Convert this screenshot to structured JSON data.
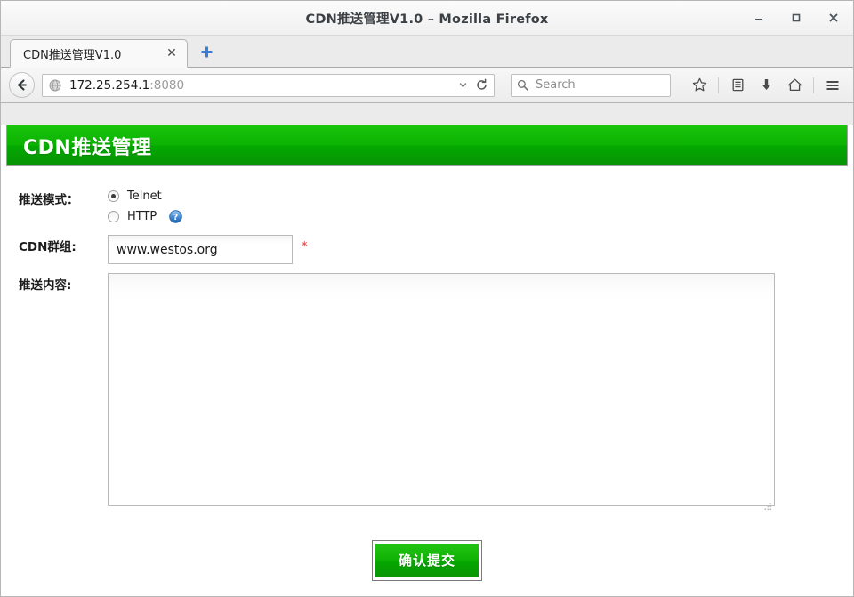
{
  "window": {
    "title": "CDN推送管理V1.0 – Mozilla Firefox",
    "minimize_label": "–",
    "maximize_label": "□",
    "close_label": "×"
  },
  "browser": {
    "tab": {
      "label": "CDN推送管理V1.0",
      "close_label": "✕"
    },
    "new_tab_label": "+",
    "back_label": "Back",
    "url": {
      "host": "172.25.254.1",
      "port": ":8080",
      "full": "172.25.254.1:8080"
    },
    "search": {
      "placeholder": "Search"
    },
    "toolbar_icons": [
      {
        "name": "bookmark-star-icon",
        "label": "Bookmark this page"
      },
      {
        "name": "library-icon",
        "label": "Show your bookmarks"
      },
      {
        "name": "downloads-icon",
        "label": "Downloads"
      },
      {
        "name": "home-icon",
        "label": "Home"
      },
      {
        "name": "menu-hamburger-icon",
        "label": "Open menu"
      }
    ]
  },
  "page": {
    "banner_title": "CDN推送管理",
    "form": {
      "mode": {
        "label": "推送模式：",
        "options": [
          {
            "value": "telnet",
            "label": "Telnet",
            "checked": true,
            "help": false
          },
          {
            "value": "http",
            "label": "HTTP",
            "checked": false,
            "help": true
          }
        ],
        "help_icon_name": "help-question-icon"
      },
      "group": {
        "label": "CDN群组:",
        "value": "www.westos.org",
        "placeholder": "",
        "required_marker": "*"
      },
      "content": {
        "label": "推送内容:",
        "value": "",
        "placeholder": ""
      },
      "submit": {
        "label": "确认提交"
      }
    }
  },
  "colors": {
    "brand_green_light": "#19c40c",
    "brand_green_dark": "#089306",
    "required_red": "#e03030",
    "chrome_gray": "#ebebeb",
    "url_port_gray": "#9a9a9a"
  }
}
